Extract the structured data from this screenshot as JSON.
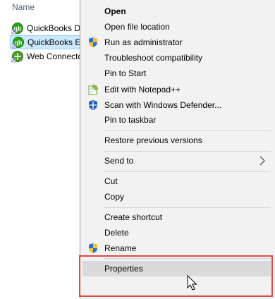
{
  "explorer": {
    "column_header": "Name",
    "files": [
      {
        "name": "QuickBooks Database Server Manager",
        "icon": "quickbooks-icon",
        "selected": false
      },
      {
        "name": "QuickBooks Enterprise",
        "icon": "quickbooks-icon",
        "selected": true
      },
      {
        "name": "Web Connector",
        "icon": "web-connector-icon",
        "selected": false
      }
    ]
  },
  "context_menu": {
    "items": [
      {
        "label": "Open",
        "bold": true,
        "icon": ""
      },
      {
        "label": "Open file location",
        "icon": ""
      },
      {
        "label": "Run as administrator",
        "icon": "uac-shield-icon"
      },
      {
        "label": "Troubleshoot compatibility",
        "icon": ""
      },
      {
        "label": "Pin to Start",
        "icon": ""
      },
      {
        "label": "Edit with Notepad++",
        "icon": "notepad-plus-plus-icon"
      },
      {
        "label": "Scan with Windows Defender...",
        "icon": "windows-defender-icon"
      },
      {
        "label": "Pin to taskbar",
        "icon": ""
      },
      {
        "label": "Restore previous versions",
        "icon": ""
      },
      {
        "label": "Send to",
        "icon": "",
        "submenu": true
      },
      {
        "label": "Cut",
        "icon": ""
      },
      {
        "label": "Copy",
        "icon": ""
      },
      {
        "label": "Create shortcut",
        "icon": ""
      },
      {
        "label": "Delete",
        "icon": ""
      },
      {
        "label": "Rename",
        "icon": "uac-shield-icon"
      },
      {
        "label": "Properties",
        "icon": "",
        "hovered": true
      }
    ]
  },
  "colors": {
    "menu_background": "#f2f2f2",
    "hover": "#dadada",
    "selection": "#cce8ff",
    "highlight_box": "#e04848"
  }
}
